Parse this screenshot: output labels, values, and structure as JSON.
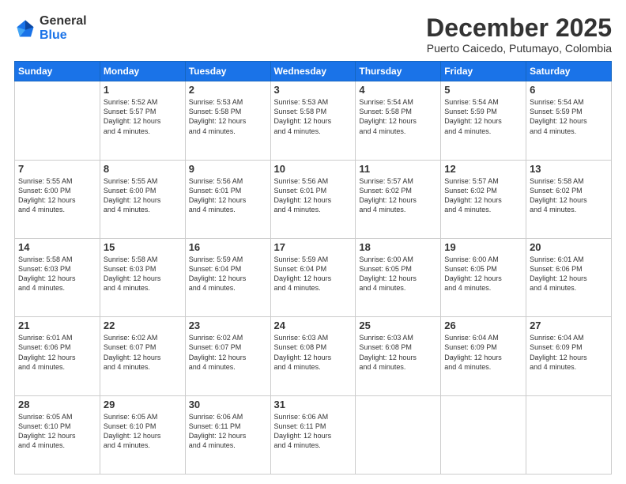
{
  "logo": {
    "general": "General",
    "blue": "Blue"
  },
  "header": {
    "month": "December 2025",
    "location": "Puerto Caicedo, Putumayo, Colombia"
  },
  "days_of_week": [
    "Sunday",
    "Monday",
    "Tuesday",
    "Wednesday",
    "Thursday",
    "Friday",
    "Saturday"
  ],
  "weeks": [
    [
      {
        "day": "",
        "info": ""
      },
      {
        "day": "1",
        "info": "Sunrise: 5:52 AM\nSunset: 5:57 PM\nDaylight: 12 hours\nand 4 minutes."
      },
      {
        "day": "2",
        "info": "Sunrise: 5:53 AM\nSunset: 5:58 PM\nDaylight: 12 hours\nand 4 minutes."
      },
      {
        "day": "3",
        "info": "Sunrise: 5:53 AM\nSunset: 5:58 PM\nDaylight: 12 hours\nand 4 minutes."
      },
      {
        "day": "4",
        "info": "Sunrise: 5:54 AM\nSunset: 5:58 PM\nDaylight: 12 hours\nand 4 minutes."
      },
      {
        "day": "5",
        "info": "Sunrise: 5:54 AM\nSunset: 5:59 PM\nDaylight: 12 hours\nand 4 minutes."
      },
      {
        "day": "6",
        "info": "Sunrise: 5:54 AM\nSunset: 5:59 PM\nDaylight: 12 hours\nand 4 minutes."
      }
    ],
    [
      {
        "day": "7",
        "info": "Sunrise: 5:55 AM\nSunset: 6:00 PM\nDaylight: 12 hours\nand 4 minutes."
      },
      {
        "day": "8",
        "info": "Sunrise: 5:55 AM\nSunset: 6:00 PM\nDaylight: 12 hours\nand 4 minutes."
      },
      {
        "day": "9",
        "info": "Sunrise: 5:56 AM\nSunset: 6:01 PM\nDaylight: 12 hours\nand 4 minutes."
      },
      {
        "day": "10",
        "info": "Sunrise: 5:56 AM\nSunset: 6:01 PM\nDaylight: 12 hours\nand 4 minutes."
      },
      {
        "day": "11",
        "info": "Sunrise: 5:57 AM\nSunset: 6:02 PM\nDaylight: 12 hours\nand 4 minutes."
      },
      {
        "day": "12",
        "info": "Sunrise: 5:57 AM\nSunset: 6:02 PM\nDaylight: 12 hours\nand 4 minutes."
      },
      {
        "day": "13",
        "info": "Sunrise: 5:58 AM\nSunset: 6:02 PM\nDaylight: 12 hours\nand 4 minutes."
      }
    ],
    [
      {
        "day": "14",
        "info": "Sunrise: 5:58 AM\nSunset: 6:03 PM\nDaylight: 12 hours\nand 4 minutes."
      },
      {
        "day": "15",
        "info": "Sunrise: 5:58 AM\nSunset: 6:03 PM\nDaylight: 12 hours\nand 4 minutes."
      },
      {
        "day": "16",
        "info": "Sunrise: 5:59 AM\nSunset: 6:04 PM\nDaylight: 12 hours\nand 4 minutes."
      },
      {
        "day": "17",
        "info": "Sunrise: 5:59 AM\nSunset: 6:04 PM\nDaylight: 12 hours\nand 4 minutes."
      },
      {
        "day": "18",
        "info": "Sunrise: 6:00 AM\nSunset: 6:05 PM\nDaylight: 12 hours\nand 4 minutes."
      },
      {
        "day": "19",
        "info": "Sunrise: 6:00 AM\nSunset: 6:05 PM\nDaylight: 12 hours\nand 4 minutes."
      },
      {
        "day": "20",
        "info": "Sunrise: 6:01 AM\nSunset: 6:06 PM\nDaylight: 12 hours\nand 4 minutes."
      }
    ],
    [
      {
        "day": "21",
        "info": "Sunrise: 6:01 AM\nSunset: 6:06 PM\nDaylight: 12 hours\nand 4 minutes."
      },
      {
        "day": "22",
        "info": "Sunrise: 6:02 AM\nSunset: 6:07 PM\nDaylight: 12 hours\nand 4 minutes."
      },
      {
        "day": "23",
        "info": "Sunrise: 6:02 AM\nSunset: 6:07 PM\nDaylight: 12 hours\nand 4 minutes."
      },
      {
        "day": "24",
        "info": "Sunrise: 6:03 AM\nSunset: 6:08 PM\nDaylight: 12 hours\nand 4 minutes."
      },
      {
        "day": "25",
        "info": "Sunrise: 6:03 AM\nSunset: 6:08 PM\nDaylight: 12 hours\nand 4 minutes."
      },
      {
        "day": "26",
        "info": "Sunrise: 6:04 AM\nSunset: 6:09 PM\nDaylight: 12 hours\nand 4 minutes."
      },
      {
        "day": "27",
        "info": "Sunrise: 6:04 AM\nSunset: 6:09 PM\nDaylight: 12 hours\nand 4 minutes."
      }
    ],
    [
      {
        "day": "28",
        "info": "Sunrise: 6:05 AM\nSunset: 6:10 PM\nDaylight: 12 hours\nand 4 minutes."
      },
      {
        "day": "29",
        "info": "Sunrise: 6:05 AM\nSunset: 6:10 PM\nDaylight: 12 hours\nand 4 minutes."
      },
      {
        "day": "30",
        "info": "Sunrise: 6:06 AM\nSunset: 6:11 PM\nDaylight: 12 hours\nand 4 minutes."
      },
      {
        "day": "31",
        "info": "Sunrise: 6:06 AM\nSunset: 6:11 PM\nDaylight: 12 hours\nand 4 minutes."
      },
      {
        "day": "",
        "info": ""
      },
      {
        "day": "",
        "info": ""
      },
      {
        "day": "",
        "info": ""
      }
    ]
  ]
}
